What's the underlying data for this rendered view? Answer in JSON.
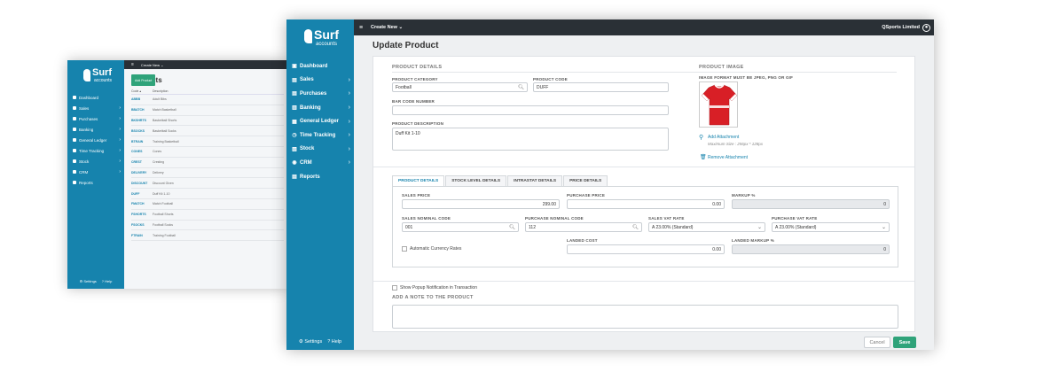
{
  "back_window": {
    "logo": {
      "name": "Surf",
      "sub": "accounts"
    },
    "topbar": {
      "create_new": "Create New ⌄"
    },
    "title": "Products",
    "add_button": "Add Product",
    "nav": [
      {
        "label": "Dashboard",
        "chev": ""
      },
      {
        "label": "Sales",
        "chev": "›"
      },
      {
        "label": "Purchases",
        "chev": "›"
      },
      {
        "label": "Banking",
        "chev": "›"
      },
      {
        "label": "General Ledger",
        "chev": "›"
      },
      {
        "label": "Time Tracking",
        "chev": "›"
      },
      {
        "label": "Stock",
        "chev": "›"
      },
      {
        "label": "CRM",
        "chev": "›"
      },
      {
        "label": "Reports",
        "chev": ""
      }
    ],
    "footer": {
      "settings": "⚙ Settings",
      "help": "? Help"
    },
    "columns": [
      "Code ▴",
      "Description"
    ],
    "rows": [
      {
        "code": "ABBB",
        "desc": "Adult Bibs"
      },
      {
        "code": "BBATCH",
        "desc": "Match Basketball"
      },
      {
        "code": "BKSHRTS",
        "desc": "Basketball Shorts"
      },
      {
        "code": "BSOCKS",
        "desc": "Basketball Socks"
      },
      {
        "code": "BTRAIN",
        "desc": "Training Basketball"
      },
      {
        "code": "CONES",
        "desc": "Cones"
      },
      {
        "code": "CREST",
        "desc": "Cresting"
      },
      {
        "code": "DELIVERY",
        "desc": "Delivery"
      },
      {
        "code": "DISCOUNT",
        "desc": "Discount Given"
      },
      {
        "code": "DUFF",
        "desc": "Duff Kit 1-10"
      },
      {
        "code": "FMATCH",
        "desc": "Match Football"
      },
      {
        "code": "FSHORTS",
        "desc": "Football Shorts"
      },
      {
        "code": "FSOCKS",
        "desc": "Football Socks"
      },
      {
        "code": "FTRAIN",
        "desc": "Training Football"
      }
    ]
  },
  "front_window": {
    "logo": {
      "name": "Surf",
      "sub": "accounts"
    },
    "topbar": {
      "create_new": "Create New ⌄",
      "company": "QSports Limited"
    },
    "nav": [
      {
        "label": "Dashboard",
        "icon": "▣",
        "chev": ""
      },
      {
        "label": "Sales",
        "icon": "▤",
        "chev": "›"
      },
      {
        "label": "Purchases",
        "icon": "▤",
        "chev": "›"
      },
      {
        "label": "Banking",
        "icon": "▥",
        "chev": "›"
      },
      {
        "label": "General Ledger",
        "icon": "▦",
        "chev": "›"
      },
      {
        "label": "Time Tracking",
        "icon": "◷",
        "chev": "›"
      },
      {
        "label": "Stock",
        "icon": "▧",
        "chev": "›"
      },
      {
        "label": "CRM",
        "icon": "◉",
        "chev": "›"
      },
      {
        "label": "Reports",
        "icon": "▤",
        "chev": ""
      }
    ],
    "footer": {
      "settings": "⚙ Settings",
      "help": "? Help"
    },
    "page_title": "Update Product",
    "product_details": {
      "header": "PRODUCT DETAILS",
      "category_label": "PRODUCT CATEGORY",
      "category_value": "Football",
      "code_label": "PRODUCT CODE",
      "code_value": "DUFF",
      "barcode_label": "BAR CODE NUMBER",
      "barcode_value": "",
      "description_label": "PRODUCT DESCRIPTION",
      "description_value": "Duff Kit 1-10"
    },
    "product_image": {
      "header": "PRODUCT IMAGE",
      "format_note": "IMAGE FORMAT MUST BE JPEG, PNG OR GIF",
      "add_attachment": "Add Attachment",
      "max_size": "Maximum Size : 256px * 128px",
      "remove_attachment": "Remove Attachment"
    },
    "tabs": [
      {
        "label": "PRODUCT DETAILS",
        "active": true
      },
      {
        "label": "STOCK LEVEL DETAILS",
        "active": false
      },
      {
        "label": "INTRASTAT DETAILS",
        "active": false
      },
      {
        "label": "PRICE DETAILS",
        "active": false
      }
    ],
    "pricing": {
      "sales_price_label": "SALES PRICE",
      "sales_price_value": "299.00",
      "purchase_price_label": "PURCHASE PRICE",
      "purchase_price_value": "0.00",
      "markup_label": "MARKUP %",
      "markup_value": "0",
      "sales_nominal_label": "SALES NOMINAL CODE",
      "sales_nominal_value": "001",
      "purchase_nominal_label": "PURCHASE NOMINAL CODE",
      "purchase_nominal_value": "112",
      "sales_vat_label": "SALES VAT RATE",
      "sales_vat_value": "A 23.00% (Standard)",
      "purchase_vat_label": "PURCHASE VAT RATE",
      "purchase_vat_value": "A 23.00% (Standard)",
      "auto_currency_label": "Automatic Currency Rates",
      "landed_cost_label": "LANDED COST",
      "landed_cost_value": "0.00",
      "landed_markup_label": "LANDED MARKUP %",
      "landed_markup_value": "0"
    },
    "popup_notification_label": "Show Popup Notification in Transaction",
    "note_header": "ADD A NOTE TO THE PRODUCT",
    "note_value": "",
    "cancel_label": "Cancel",
    "save_label": "Save"
  }
}
